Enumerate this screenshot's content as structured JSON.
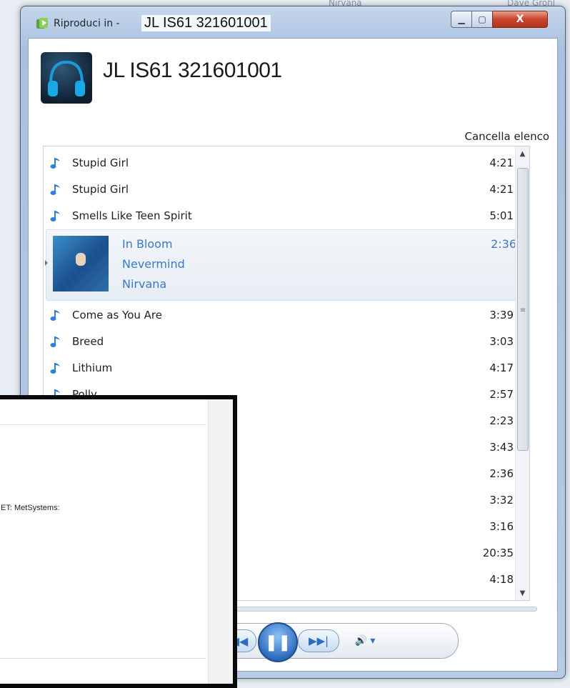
{
  "background": {
    "peek_left": "Nirvana",
    "peek_right": "Dave Grohl"
  },
  "window": {
    "title_prefix": "Riproduci in -",
    "title_device": "JL IS61 321601001",
    "minimize_icon": "minimize-icon",
    "maximize_icon": "maximize-icon",
    "close_label": "X"
  },
  "device": {
    "name": "JL IS61 321601001",
    "icon": "headphones-icon"
  },
  "actions": {
    "clear_list": "Cancella elenco"
  },
  "playlist": {
    "tracks_before": [
      {
        "title": "Stupid Girl",
        "duration": "4:21"
      },
      {
        "title": "Stupid Girl",
        "duration": "4:21"
      },
      {
        "title": "Smells Like Teen Spirit",
        "duration": "5:01"
      }
    ],
    "now_playing": {
      "title": "In Bloom",
      "album": "Nevermind",
      "artist": "Nirvana",
      "duration": "2:36"
    },
    "tracks_after": [
      {
        "title": "Come as You Are",
        "duration": "3:39"
      },
      {
        "title": "Breed",
        "duration": "3:03"
      },
      {
        "title": "Lithium",
        "duration": "4:17"
      },
      {
        "title": "Polly",
        "duration": "2:57"
      },
      {
        "title": "",
        "duration": "2:23"
      },
      {
        "title": "",
        "duration": "3:43"
      },
      {
        "title": "",
        "duration": "2:36"
      },
      {
        "title": "",
        "duration": "3:32"
      },
      {
        "title": "",
        "duration": "3:16"
      },
      {
        "title": "",
        "duration": "20:35"
      },
      {
        "title": "",
        "duration": "4:18"
      }
    ]
  },
  "transport": {
    "prev_label": "◀◀",
    "pause_label": "❚❚",
    "next_label": "▶▶|",
    "volume_label": "🔊 ▾",
    "seek_fraction": 0.04
  },
  "overlay": {
    "text": "IET: MetSystems:"
  },
  "colors": {
    "accent": "#3a79c9",
    "note": "#2f7fd6"
  }
}
